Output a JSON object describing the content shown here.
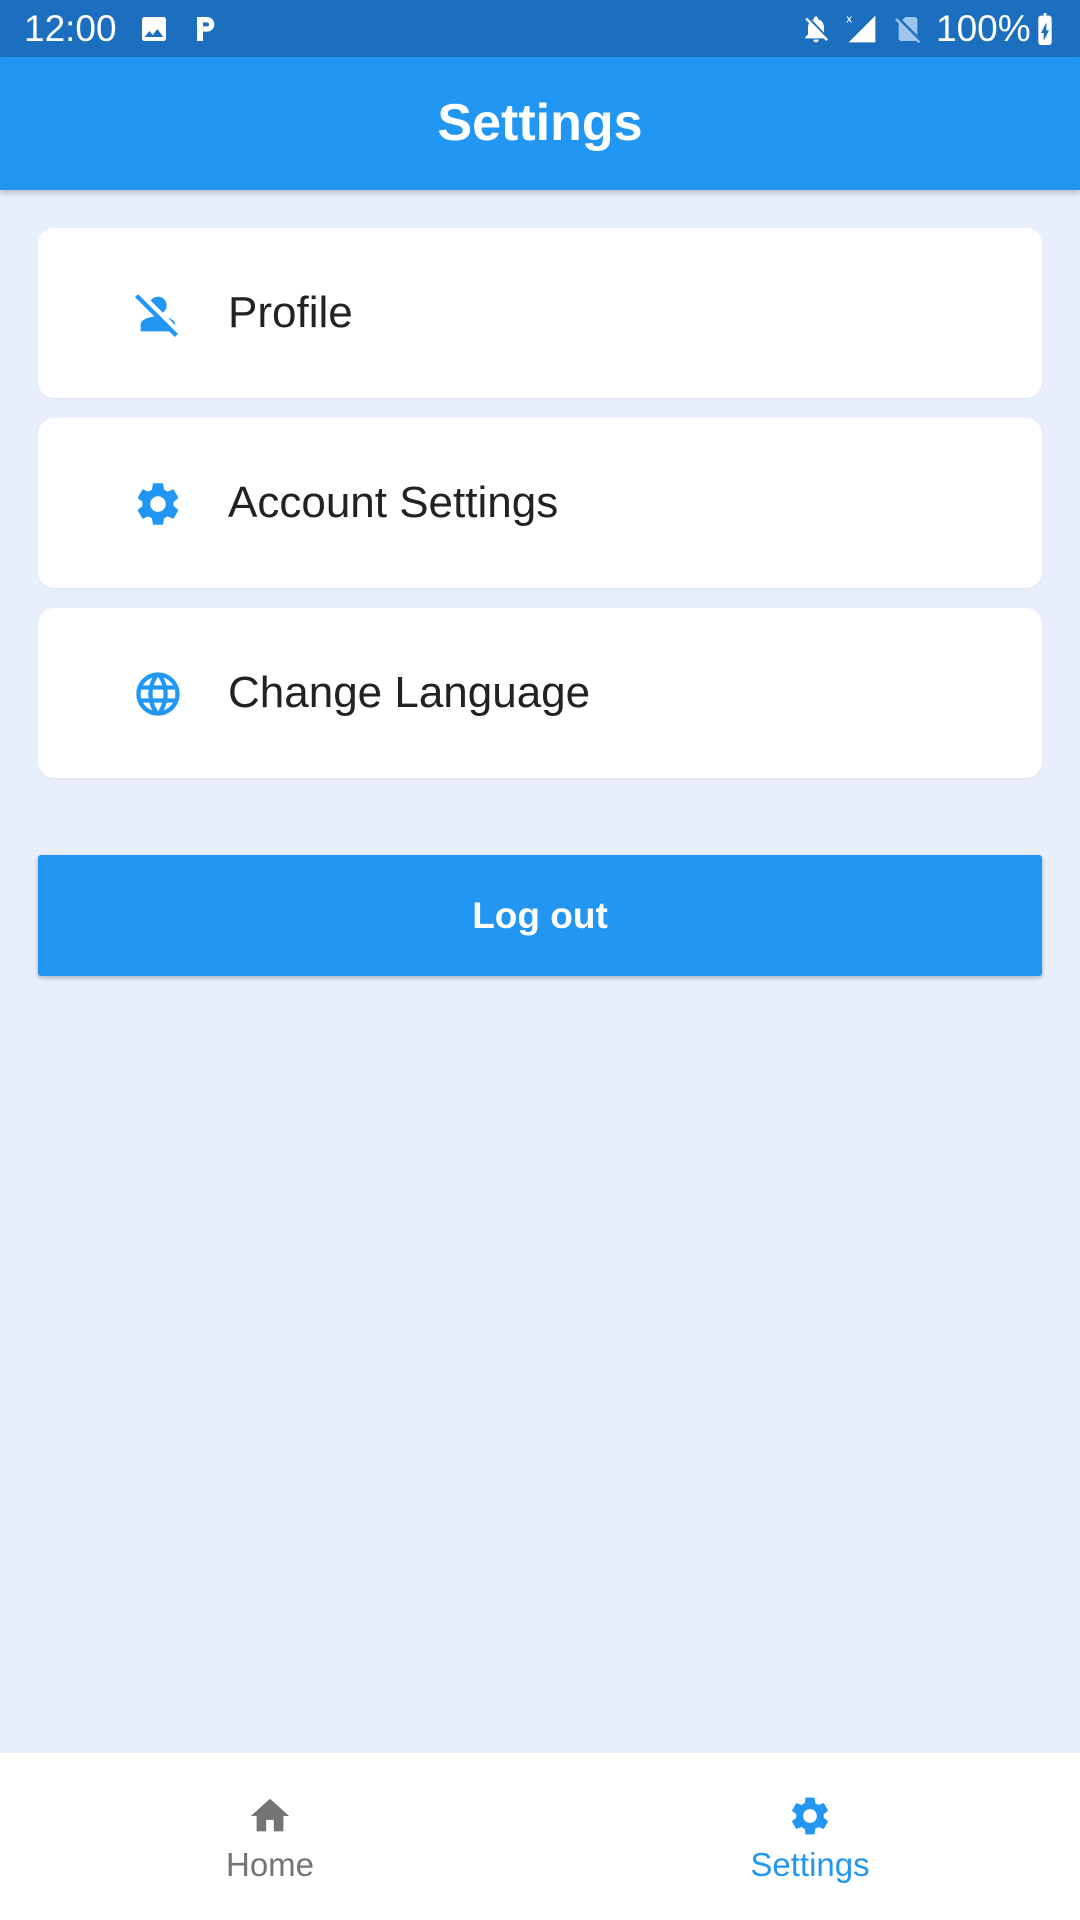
{
  "status_bar": {
    "time": "12:00",
    "battery": "100%",
    "icons": [
      "image-icon",
      "parking-icon",
      "notifications-off-icon",
      "signal-icon",
      "no-sim-icon",
      "battery-charging-icon"
    ]
  },
  "app_bar": {
    "title": "Settings"
  },
  "menu": {
    "items": [
      {
        "label": "Profile",
        "icon": "person-off-icon"
      },
      {
        "label": "Account Settings",
        "icon": "gear-icon"
      },
      {
        "label": "Change Language",
        "icon": "globe-icon"
      }
    ]
  },
  "logout": {
    "label": "Log out"
  },
  "bottom_nav": {
    "items": [
      {
        "label": "Home",
        "icon": "home-icon",
        "selected": false
      },
      {
        "label": "Settings",
        "icon": "gear-icon",
        "selected": true
      }
    ]
  },
  "colors": {
    "primary": "#2196F3",
    "status_bar": "#1B6FBE",
    "background": "#E8EEFB",
    "inactive": "#757575"
  }
}
